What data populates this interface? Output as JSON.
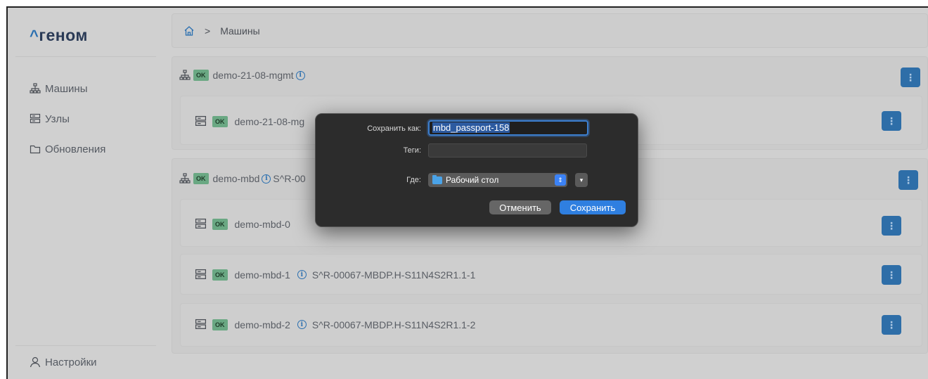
{
  "logo": {
    "caret": "^",
    "text": "геном"
  },
  "sidebar": {
    "items": [
      {
        "label": "Машины",
        "icon": "network-icon"
      },
      {
        "label": "Узлы",
        "icon": "server-icon"
      },
      {
        "label": "Обновления",
        "icon": "folder-icon"
      }
    ],
    "settings_label": "Настройки"
  },
  "breadcrumb": {
    "current": "Машины"
  },
  "groups": [
    {
      "name": "demo-21-08-mgmt",
      "status": "OK",
      "nodes": [
        {
          "name": "demo-21-08-mg",
          "status": "OK"
        }
      ]
    },
    {
      "name": "demo-mbd",
      "status": "OK",
      "serial": "S^R-00",
      "nodes": [
        {
          "name": "demo-mbd-0",
          "status": "OK"
        },
        {
          "name": "demo-mbd-1",
          "status": "OK",
          "serial": "S^R-00067-MBDP.H-S11N4S2R1.1-1"
        },
        {
          "name": "demo-mbd-2",
          "status": "OK",
          "serial": "S^R-00067-MBDP.H-S11N4S2R1.1-2"
        }
      ]
    }
  ],
  "more_glyph": "⋮",
  "dialog": {
    "save_as_label": "Сохранить как:",
    "filename": "mbd_passport-158",
    "tags_label": "Теги:",
    "tags_value": "",
    "where_label": "Где:",
    "where_value": "Рабочий стол",
    "cancel_label": "Отменить",
    "save_label": "Сохранить"
  },
  "colors": {
    "accent": "#2e6ea8",
    "ok_badge": "#6aa883",
    "dialog_bg": "#2c2c2c",
    "save_button": "#2f7fe0"
  }
}
